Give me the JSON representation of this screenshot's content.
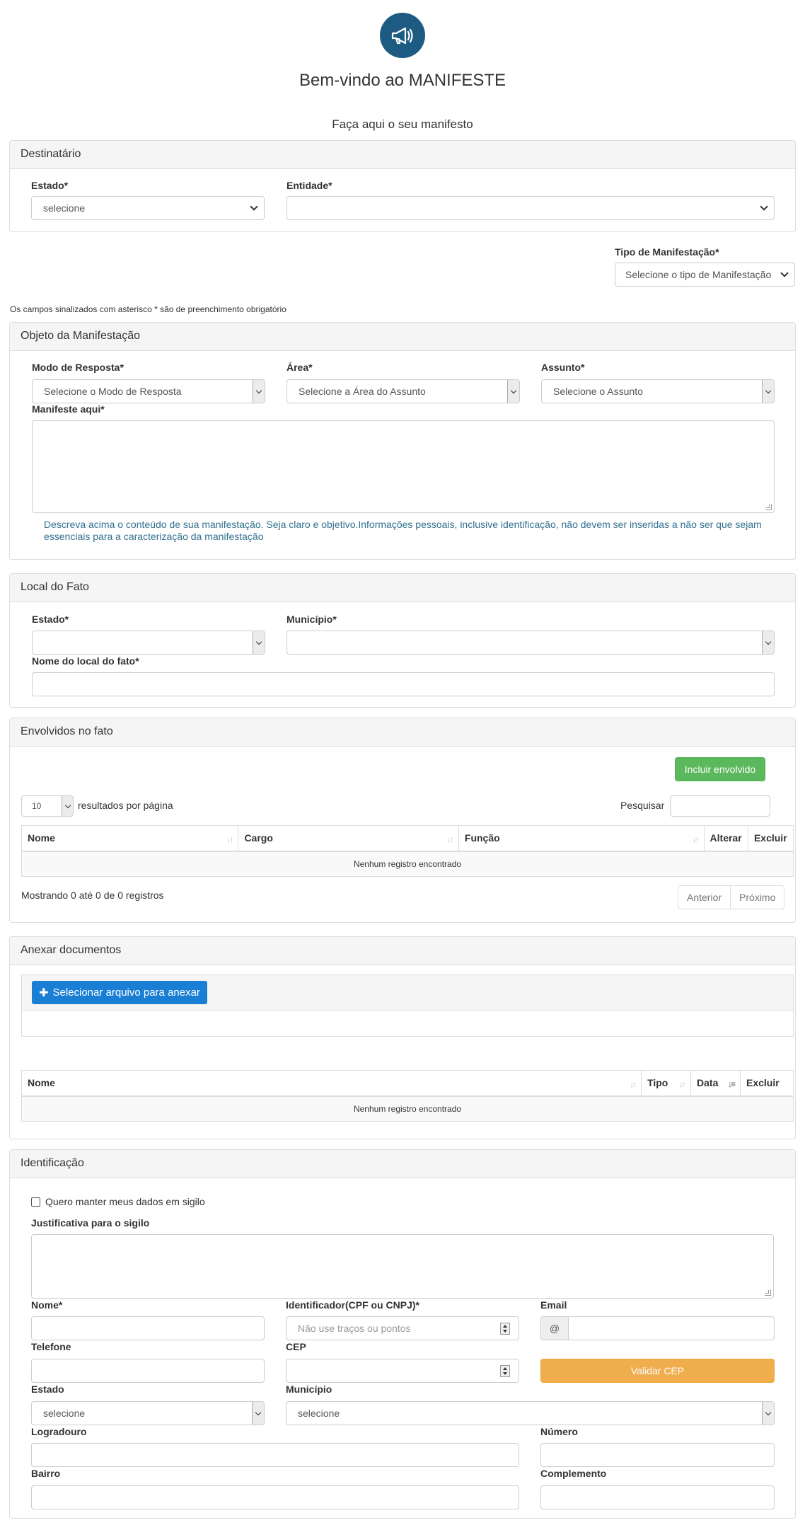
{
  "header": {
    "title": "Bem-vindo ao MANIFESTE",
    "subtitle": "Faça aqui o seu manifesto"
  },
  "destinatario": {
    "title": "Destinatário",
    "estado_label": "Estado*",
    "estado_value": "selecione",
    "entidade_label": "Entidade*",
    "entidade_value": ""
  },
  "tipo": {
    "label": "Tipo de Manifestação*",
    "value": "Selecione o tipo de Manifestação"
  },
  "required_note": "Os campos sinalizados com asterisco * são de preenchimento obrigatório",
  "objeto": {
    "title": "Objeto da Manifestação",
    "modo_label": "Modo de Resposta*",
    "modo_value": "Selecione o Modo de Resposta",
    "area_label": "Área*",
    "area_value": "Selecione a Área do Assunto",
    "assunto_label": "Assunto*",
    "assunto_value": "Selecione o Assunto",
    "manifeste_label": "Manifeste aqui*",
    "help": "Descreva acima o conteúdo de sua manifestação. Seja claro e objetivo.Informações pessoais, inclusive identificação, não devem ser inseridas a não ser que sejam essenciais para a caracterização da manifestação"
  },
  "local": {
    "title": "Local do Fato",
    "estado_label": "Estado*",
    "municipio_label": "Município*",
    "nome_label": "Nome do local do fato*"
  },
  "envolvidos": {
    "title": "Envolvidos no fato",
    "add_button": "Incluir envolvido",
    "page_size": "10",
    "page_size_label": "resultados por página",
    "search_label": "Pesquisar",
    "columns": [
      "Nome",
      "Cargo",
      "Função",
      "Alterar",
      "Excluir"
    ],
    "empty": "Nenhum registro encontrado",
    "info": "Mostrando 0 até 0 de 0 registros",
    "prev": "Anterior",
    "next": "Próximo"
  },
  "anexar": {
    "title": "Anexar documentos",
    "select_button": "Selecionar arquivo para anexar",
    "columns": [
      "Nome",
      "Tipo",
      "Data",
      "Excluir"
    ],
    "empty": "Nenhum registro encontrado"
  },
  "identificacao": {
    "title": "Identificação",
    "sigilo_label": "Quero manter meus dados em sigilo",
    "justificativa_label": "Justificativa para o sigilo",
    "nome_label": "Nome*",
    "identificador_label": "Identificador(CPF ou CNPJ)*",
    "identificador_placeholder": "Não use traços ou pontos",
    "email_label": "Email",
    "email_addon": "@",
    "telefone_label": "Telefone",
    "cep_label": "CEP",
    "validar_button": "Validar CEP",
    "estado_label": "Estado",
    "estado_value": "selecione",
    "municipio_label": "Município",
    "municipio_value": "selecione",
    "logradouro_label": "Logradouro",
    "numero_label": "Número",
    "bairro_label": "Bairro",
    "complemento_label": "Complemento"
  },
  "colors": {
    "logo": "#1d5b82",
    "green": "#5cb85c",
    "blue": "#1a7fd4",
    "orange": "#f0ad4e",
    "help": "#31708f"
  }
}
